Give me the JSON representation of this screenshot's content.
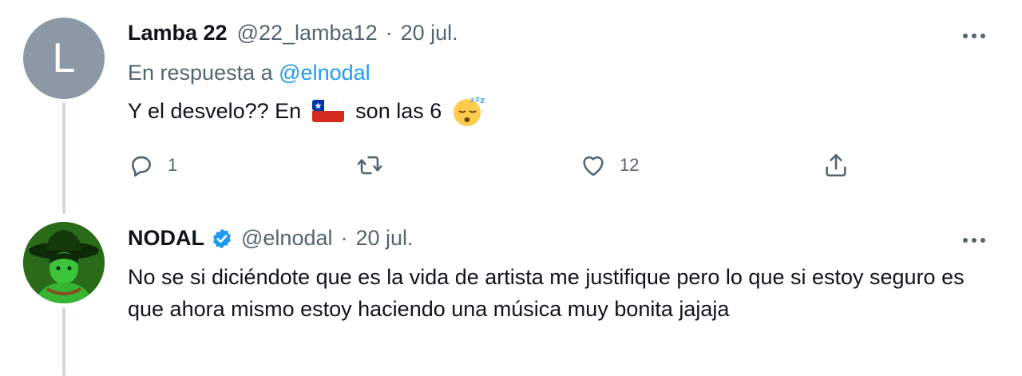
{
  "tweets": [
    {
      "avatar_letter": "L",
      "display_name": "Lamba 22",
      "handle": "@22_lamba12",
      "date": "20 jul.",
      "reply_prefix": "En respuesta a",
      "reply_handle": "@elnodal",
      "text_parts": [
        "Y el desvelo?? En",
        "son las 6"
      ],
      "flag_icon": "chile-flag-icon",
      "emoji_icon": "sleeping-face-icon",
      "reply_count": "1",
      "like_count": "12"
    },
    {
      "display_name": "NODAL",
      "verified": true,
      "handle": "@elnodal",
      "date": "20 jul.",
      "text": "No se si diciéndote que es la vida de artista me justifique pero lo que si estoy seguro es que ahora mismo estoy haciendo una música muy bonita jajaja"
    }
  ],
  "separator": "·",
  "colors": {
    "muted": "#536471",
    "link": "#1d9bf0",
    "thread_line": "#cfd9de"
  }
}
